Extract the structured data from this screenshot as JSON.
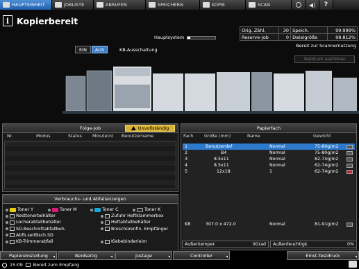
{
  "tabs": [
    {
      "label": "HAUPTEINHEIT",
      "icon": "copier-icon",
      "active": true
    },
    {
      "label": "JOBLISTE",
      "icon": "list-icon"
    },
    {
      "label": "ABRUFEN",
      "icon": "folder-icon"
    },
    {
      "label": "SPEICHERN",
      "icon": "save-icon"
    },
    {
      "label": "KOPIE",
      "icon": "copy-icon"
    },
    {
      "label": "SCAN",
      "icon": "scan-icon"
    }
  ],
  "tab_icons": [
    "globe-icon",
    "speaker-icon",
    "help-icon"
  ],
  "help_label": "?",
  "header": {
    "title": "Kopierbereit",
    "info_icon": "i"
  },
  "memory": {
    "label": "Hauptsystem",
    "fill": 0.1
  },
  "stats": {
    "orig_label": "Orig. Zähl.",
    "orig_value": "30",
    "speich_label": "Speich.",
    "speich_value": "99.999%",
    "reserve_label": "Reserve-Job",
    "reserve_value": "0",
    "datei_label": "Dateigröße",
    "datei_value": "98.812%"
  },
  "scan_ready": "Bereit zur Scannernutzung",
  "testdruck_btn": "Testdruck ausführen",
  "power": {
    "ein": "EIN",
    "aus": "AUS",
    "label": "KB-Ausschaltung"
  },
  "folge": {
    "title": "Folge-Job",
    "warn_label": "Unvollständig",
    "columns": [
      "Nr.",
      "Modus",
      "Status",
      "Minute(n)",
      "Benutzername"
    ]
  },
  "verbrauch": {
    "title": "Verbrauchs- und Abfallanzeigen",
    "rows": [
      [
        {
          "label": "Toner Y",
          "color": "#e8c81a"
        },
        {
          "label": "Toner M",
          "color": "#d81b7a"
        },
        {
          "label": "Toner C",
          "color": "#19a6d9"
        },
        {
          "label": "Toner K",
          "color": "#222222"
        }
      ],
      [
        {
          "label": "Resttonerbehälter"
        },
        {
          "label": "Zufuhr Heftklammerbox"
        }
      ],
      [
        {
          "label": "Locherabfallbehälter"
        },
        {
          "label": "Heftabfallbehälter"
        }
      ],
      [
        {
          "label": "SD-Beschnittabfallbeh."
        },
        {
          "label": "Broschürenfin. Empfänger"
        }
      ],
      [
        {
          "label": "Abfb.seitBsch.SD"
        }
      ],
      [
        {
          "label": "KB-Trimmerabfall"
        },
        {
          "label": "Klebebinderleim"
        }
      ]
    ]
  },
  "papier": {
    "title": "Papierfach",
    "columns": [
      "Fach",
      "Größe (mm)",
      "Name",
      "Gewicht"
    ],
    "rows": [
      {
        "fach": "1",
        "size": "Benutzerdef",
        "name": "Normal",
        "weight": "75-80g/m2",
        "selected": true
      },
      {
        "fach": "2",
        "size": "B4",
        "name": "Normal",
        "weight": "75-80g/m2"
      },
      {
        "fach": "3",
        "size": "8.5x11",
        "name": "Normal",
        "weight": "62-74g/m2"
      },
      {
        "fach": "4",
        "size": "8.5x11",
        "name": "Normal",
        "weight": "62-74g/m2"
      },
      {
        "fach": "5",
        "size": "12x18",
        "name": "1",
        "weight": "62-74g/m2",
        "alert": true
      }
    ],
    "kb_row": {
      "fach": "KB",
      "size": "307.0 x 472.0",
      "name": "Normal",
      "weight": "81-91g/m2"
    },
    "temp_label": "Außentemper.",
    "temp_value": "0Grad",
    "feucht_label": "Außenfeuchtigk.",
    "feucht_value": "0%"
  },
  "bottom": {
    "buttons": [
      "Papiereinstellung",
      "Beidseitig",
      "Justage",
      "Controller",
      "Einst.Testdruck"
    ]
  },
  "status": {
    "time": "15:09",
    "message": "Bereit zum Empfang"
  }
}
